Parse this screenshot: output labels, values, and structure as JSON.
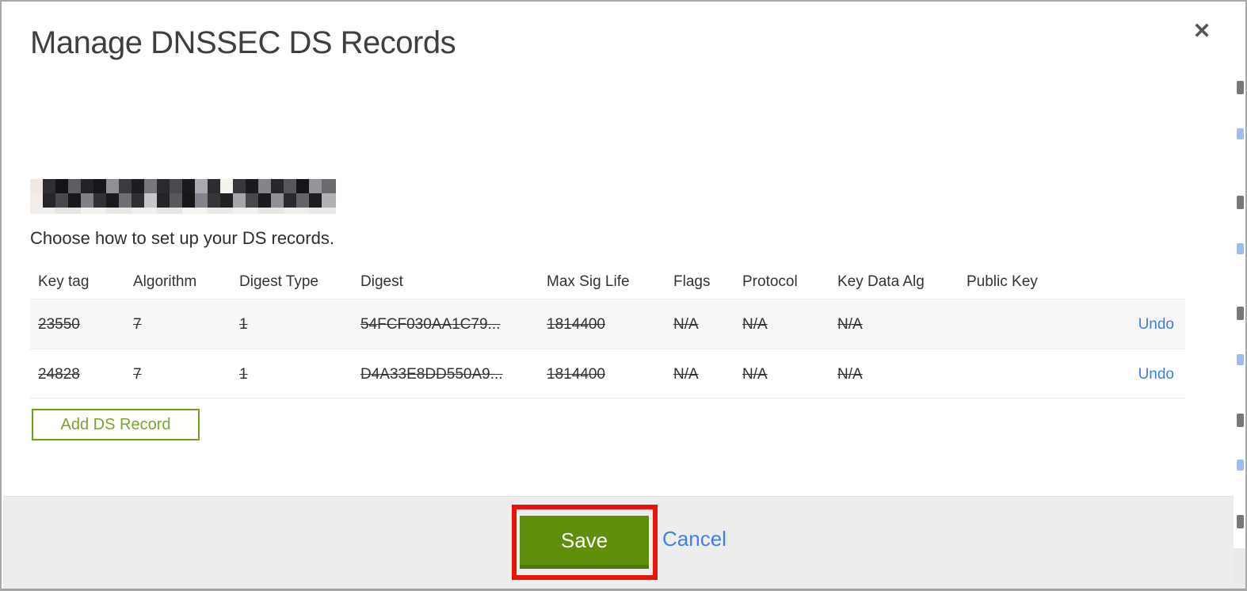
{
  "dialog": {
    "title": "Manage DNSSEC DS Records",
    "close_glyph": "✕",
    "instruction": "Choose how to set up your DS records.",
    "table": {
      "columns": [
        "Key tag",
        "Algorithm",
        "Digest Type",
        "Digest",
        "Max Sig Life",
        "Flags",
        "Protocol",
        "Key Data Alg",
        "Public Key"
      ],
      "rows": [
        {
          "key_tag": "23550",
          "algorithm": "7",
          "digest_type": "1",
          "digest": "54FCF030AA1C79...",
          "max_sig_life": "1814400",
          "flags": "N/A",
          "protocol": "N/A",
          "key_data_alg": "N/A",
          "public_key": "",
          "undo_label": "Undo",
          "state": "marked-for-deletion"
        },
        {
          "key_tag": "24828",
          "algorithm": "7",
          "digest_type": "1",
          "digest": "D4A33E8DD550A9...",
          "max_sig_life": "1814400",
          "flags": "N/A",
          "protocol": "N/A",
          "key_data_alg": "N/A",
          "public_key": "",
          "undo_label": "Undo",
          "state": "marked-for-deletion"
        }
      ]
    },
    "add_ds_record_label": "Add DS Record",
    "save_label": "Save",
    "cancel_label": "Cancel"
  },
  "colors": {
    "save_button_green": "#5f8e08",
    "save_button_green_dark": "#4b7a04",
    "outline_button_green": "#67a11b",
    "link_blue": "#3d7ce6",
    "annotation_red": "#e8140b",
    "footer_bg": "#ededed",
    "row_shaded_bg": "#f7f7f7",
    "title_text": "#413f3d"
  }
}
